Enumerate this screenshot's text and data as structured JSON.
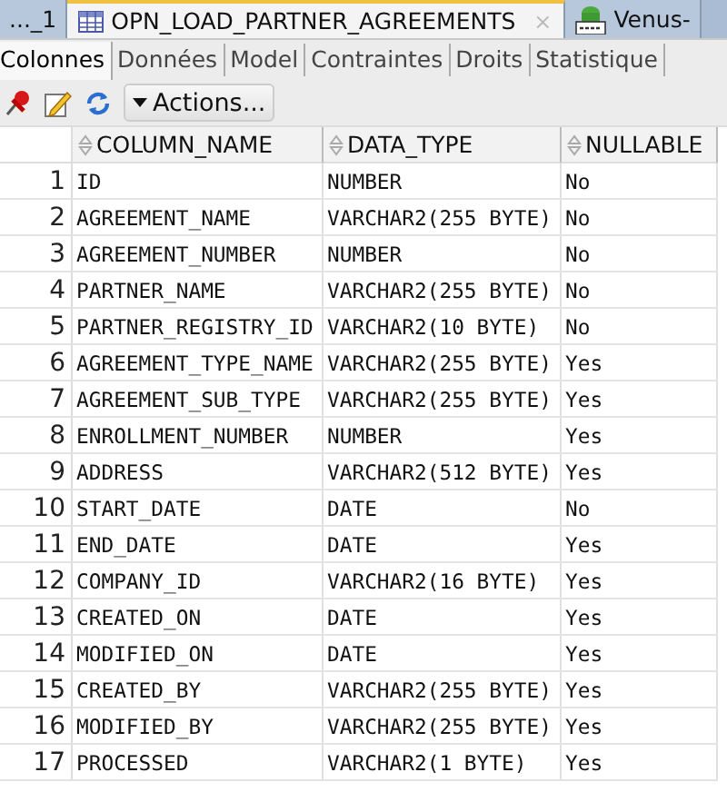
{
  "editor_tabs": [
    {
      "label": "..._1",
      "kind": "plain",
      "selected": false
    },
    {
      "label": "OPN_LOAD_PARTNER_AGREEMENTS",
      "kind": "table",
      "selected": true
    },
    {
      "label": "Venus-",
      "kind": "sql",
      "selected": false
    }
  ],
  "close_glyph": "×",
  "tabs": [
    {
      "label": "Colonnes",
      "selected": true
    },
    {
      "label": "Données",
      "selected": false
    },
    {
      "label": "Model",
      "selected": false
    },
    {
      "label": "Contraintes",
      "selected": false
    },
    {
      "label": "Droits",
      "selected": false
    },
    {
      "label": "Statistique",
      "selected": false
    }
  ],
  "toolbar": {
    "actions_button": "Actions..."
  },
  "table": {
    "columns": [
      "",
      "COLUMN_NAME",
      "DATA_TYPE",
      "NULLABLE"
    ],
    "rows": [
      [
        "1",
        "ID",
        "NUMBER",
        "No"
      ],
      [
        "2",
        "AGREEMENT_NAME",
        "VARCHAR2(255 BYTE)",
        "No"
      ],
      [
        "3",
        "AGREEMENT_NUMBER",
        "NUMBER",
        "No"
      ],
      [
        "4",
        "PARTNER_NAME",
        "VARCHAR2(255 BYTE)",
        "No"
      ],
      [
        "5",
        "PARTNER_REGISTRY_ID",
        "VARCHAR2(10 BYTE)",
        "No"
      ],
      [
        "6",
        "AGREEMENT_TYPE_NAME",
        "VARCHAR2(255 BYTE)",
        "Yes"
      ],
      [
        "7",
        "AGREEMENT_SUB_TYPE",
        "VARCHAR2(255 BYTE)",
        "Yes"
      ],
      [
        "8",
        "ENROLLMENT_NUMBER",
        "NUMBER",
        "Yes"
      ],
      [
        "9",
        "ADDRESS",
        "VARCHAR2(512 BYTE)",
        "Yes"
      ],
      [
        "10",
        "START_DATE",
        "DATE",
        "No"
      ],
      [
        "11",
        "END_DATE",
        "DATE",
        "Yes"
      ],
      [
        "12",
        "COMPANY_ID",
        "VARCHAR2(16 BYTE)",
        "Yes"
      ],
      [
        "13",
        "CREATED_ON",
        "DATE",
        "Yes"
      ],
      [
        "14",
        "MODIFIED_ON",
        "DATE",
        "Yes"
      ],
      [
        "15",
        "CREATED_BY",
        "VARCHAR2(255 BYTE)",
        "Yes"
      ],
      [
        "16",
        "MODIFIED_BY",
        "VARCHAR2(255 BYTE)",
        "Yes"
      ],
      [
        "17",
        "PROCESSED",
        "VARCHAR2(1 BYTE)",
        "Yes"
      ]
    ]
  }
}
